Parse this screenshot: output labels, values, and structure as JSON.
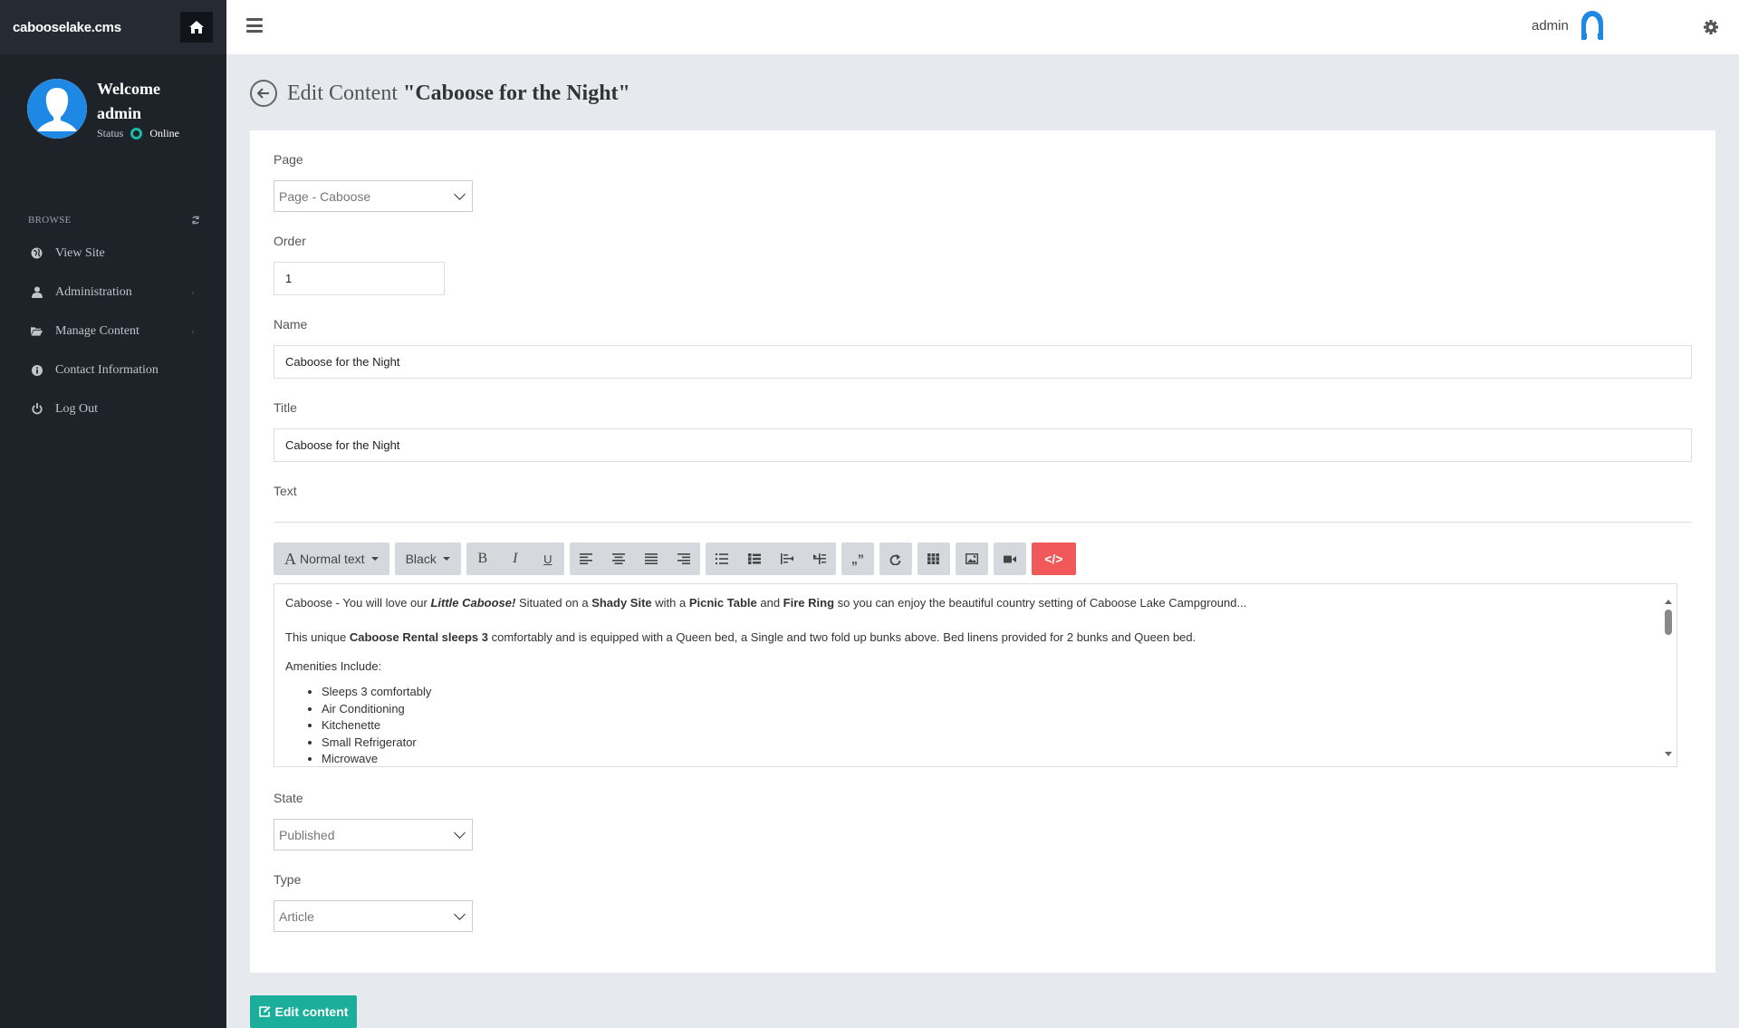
{
  "brand": "cabooselake.cms",
  "user": {
    "welcome_line1": "Welcome",
    "welcome_line2": "admin",
    "status_label": "Status",
    "status_value": "Online",
    "top_username": "admin"
  },
  "sidebar": {
    "section_label": "BROWSE",
    "items": [
      {
        "label": "View Site",
        "icon": "globe-icon"
      },
      {
        "label": "Administration",
        "icon": "user-icon",
        "has_submenu": true
      },
      {
        "label": "Manage Content",
        "icon": "folder-open-icon",
        "has_submenu": true
      },
      {
        "label": "Contact Information",
        "icon": "info-circle-icon"
      },
      {
        "label": "Log Out",
        "icon": "power-icon"
      }
    ]
  },
  "header": {
    "title_prefix": "Edit Content ",
    "title_name": "\"Caboose for the Night\""
  },
  "form": {
    "page_label": "Page",
    "page_value": "Page - Caboose",
    "order_label": "Order",
    "order_value": "1",
    "name_label": "Name",
    "name_value": "Caboose for the Night",
    "title_label": "Title",
    "title_value": "Caboose for the Night",
    "text_label": "Text",
    "state_label": "State",
    "state_value": "Published",
    "type_label": "Type",
    "type_value": "Article",
    "submit_label": "Edit content"
  },
  "toolbar": {
    "format_label": "Normal text",
    "color_label": "Black",
    "bold": "B",
    "italic": "I",
    "underline": "U",
    "quote": "„”",
    "html": "</>"
  },
  "editor": {
    "p1_a": "Caboose - You will love our ",
    "p1_b": "Little Caboose!",
    "p1_c": " Situated on a ",
    "p1_d": "Shady Site",
    "p1_e": " with a ",
    "p1_f": "Picnic Table",
    "p1_g": " and ",
    "p1_h": "Fire Ring",
    "p1_i": " so you can enjoy the beautiful country setting of Caboose Lake Campground...",
    "p2_a": "This unique ",
    "p2_b": "Caboose Rental sleeps 3",
    "p2_c": " comfortably and is equipped with a Queen bed, a Single and two fold up bunks above. Bed linens provided for 2 bunks and Queen bed.",
    "p3": "Amenities Include:",
    "amenities": [
      "Sleeps 3 comfortably",
      "Air Conditioning",
      "Kitchenette",
      "Small Refrigerator",
      "Microwave"
    ]
  },
  "colors": {
    "sidebar_bg": "#1e2229",
    "accent_teal": "#1aae9b",
    "danger_red": "#f0585a",
    "avatar_blue": "#1e88e5"
  }
}
